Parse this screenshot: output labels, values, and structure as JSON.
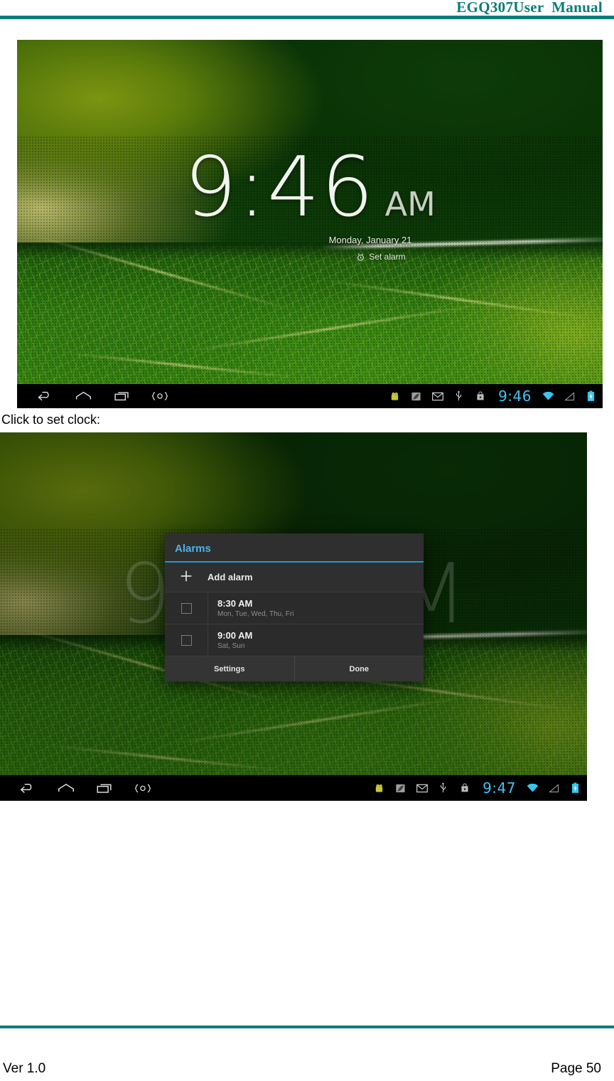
{
  "header": {
    "title": "EGQ307User  Manual",
    "accent_color": "#0a7d78"
  },
  "footer": {
    "version": "Ver 1.0",
    "page": "Page 50"
  },
  "body": {
    "caption": "Click to set clock:"
  },
  "screenshot_clock": {
    "name": "android-clock-screen",
    "clock": {
      "time": "9:46",
      "ampm": "AM",
      "date": "Monday, January 21",
      "set_alarm_label": "Set alarm",
      "alarm_icon": "alarm-clock-icon"
    },
    "navbar": {
      "buttons": [
        {
          "icon": "back-icon",
          "label": "Back"
        },
        {
          "icon": "home-icon",
          "label": "Home"
        },
        {
          "icon": "recent-apps-icon",
          "label": "Recent apps"
        },
        {
          "icon": "screenshot-icon",
          "label": "Screenshot"
        }
      ],
      "status_icons": [
        "android-robot-icon",
        "leaf-icon",
        "gmail-icon",
        "usb-icon",
        "play-store-icon"
      ],
      "time": "9:46",
      "trailing_icons": [
        "wifi-icon",
        "signal-icon",
        "battery-icon"
      ]
    }
  },
  "screenshot_alarms": {
    "name": "android-alarms-dialog-screen",
    "background_clock": {
      "time": "9",
      "ampm": "M"
    },
    "dialog": {
      "title": "Alarms",
      "add_alarm": {
        "icon": "plus-icon",
        "label": "Add alarm"
      },
      "alarms": [
        {
          "time": "8:30 AM",
          "days": "Mon, Tue, Wed, Thu, Fri",
          "enabled": false
        },
        {
          "time": "9:00 AM",
          "days": "Sat, Sun",
          "enabled": false
        }
      ],
      "buttons": [
        {
          "label": "Settings"
        },
        {
          "label": "Done"
        }
      ],
      "accent_color": "#4ab3e8"
    },
    "navbar": {
      "buttons": [
        {
          "icon": "back-icon",
          "label": "Back"
        },
        {
          "icon": "home-icon",
          "label": "Home"
        },
        {
          "icon": "recent-apps-icon",
          "label": "Recent apps"
        },
        {
          "icon": "screenshot-icon",
          "label": "Screenshot"
        }
      ],
      "status_icons": [
        "android-robot-icon",
        "leaf-icon",
        "gmail-icon",
        "usb-icon",
        "play-store-icon"
      ],
      "time": "9:47",
      "trailing_icons": [
        "wifi-icon",
        "signal-icon",
        "battery-icon"
      ]
    }
  }
}
